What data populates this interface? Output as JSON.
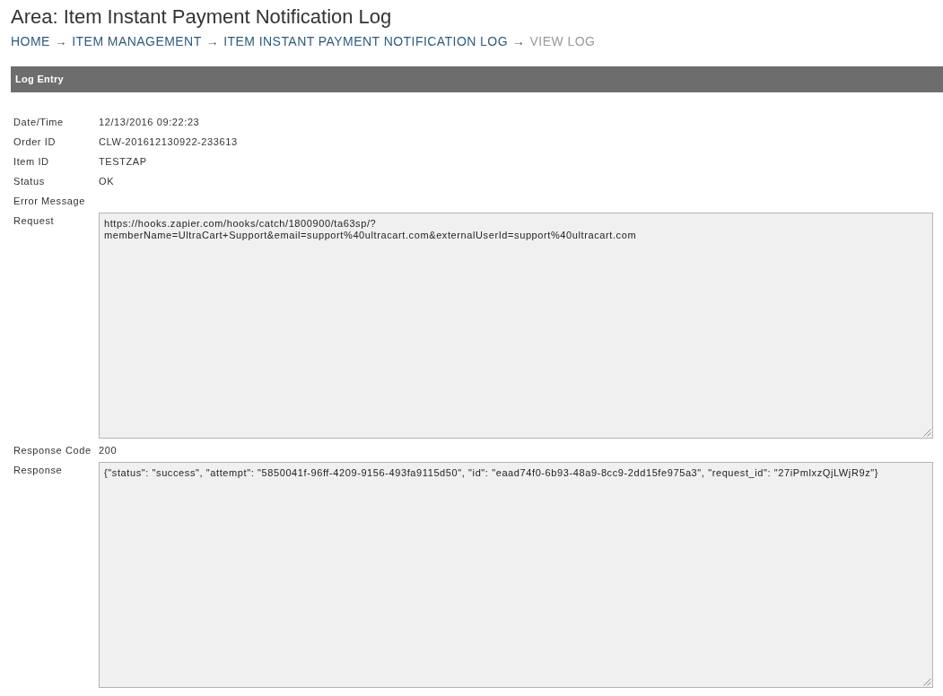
{
  "page_title": "Area: Item Instant Payment Notification Log",
  "breadcrumb": [
    {
      "kind": "link",
      "label": "HOME"
    },
    {
      "kind": "separator",
      "label": "→"
    },
    {
      "kind": "link",
      "label": "ITEM MANAGEMENT"
    },
    {
      "kind": "separator",
      "label": "→"
    },
    {
      "kind": "link",
      "label": "ITEM INSTANT PAYMENT NOTIFICATION LOG"
    },
    {
      "kind": "separator",
      "label": "→"
    },
    {
      "kind": "current",
      "label": "VIEW LOG"
    }
  ],
  "log_entry": {
    "title": "Log Entry",
    "fields": [
      {
        "kind": "text",
        "label": "Date/Time",
        "value": "12/13/2016 09:22:23"
      },
      {
        "kind": "text",
        "label": "Order ID",
        "value": "CLW-201612130922-233613"
      },
      {
        "kind": "text",
        "label": "Item ID",
        "value": "TESTZAP"
      },
      {
        "kind": "text",
        "label": "Status",
        "value": "OK"
      },
      {
        "kind": "text",
        "label": "Error Message"
      },
      {
        "kind": "textarea",
        "label": "Request",
        "value": "https://hooks.zapier.com/hooks/catch/1800900/ta63sp/?\nmemberName=UltraCart+Support&email=support%40ultracart.com&externalUserId=support%40ultracart.com"
      },
      {
        "kind": "text",
        "label": "Response Code",
        "value": "200"
      },
      {
        "kind": "textarea",
        "label": "Response",
        "value": "{\"status\": \"success\", \"attempt\": \"5850041f-96ff-4209-9156-493fa9115d50\", \"id\": \"eaad74f0-6b93-48a9-8cc9-2dd15fe975a3\", \"request_id\": \"27iPmlxzQjLWjR9z\"}"
      }
    ]
  }
}
